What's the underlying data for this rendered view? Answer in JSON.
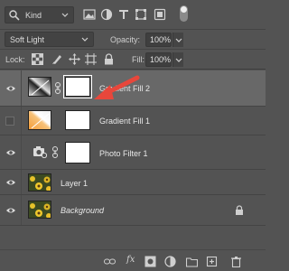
{
  "filter": {
    "kind_label": "Kind",
    "icons": [
      "image-filter-icon",
      "adjustment-filter-icon",
      "type-filter-icon",
      "shape-filter-icon",
      "smart-object-filter-icon",
      "filter-toggle"
    ]
  },
  "blend": {
    "mode": "Soft Light",
    "opacity_label": "Opacity:",
    "opacity_value": "100%"
  },
  "lock": {
    "label": "Lock:",
    "fill_label": "Fill:",
    "fill_value": "100%",
    "icons": [
      "lock-transparent-pixels-icon",
      "lock-image-pixels-icon",
      "lock-position-icon",
      "lock-artboard-icon",
      "lock-all-icon"
    ]
  },
  "layers": [
    {
      "name": "Gradient Fill 2",
      "visible": true,
      "selected": true,
      "type": "gradient-fill",
      "italic": false
    },
    {
      "name": "Gradient Fill 1",
      "visible": false,
      "selected": false,
      "type": "gradient-fill",
      "italic": false
    },
    {
      "name": "Photo Filter 1",
      "visible": true,
      "selected": false,
      "type": "photo-filter",
      "italic": false
    },
    {
      "name": "Layer 1",
      "visible": true,
      "selected": false,
      "type": "pixel",
      "italic": false
    },
    {
      "name": "Background",
      "visible": true,
      "selected": false,
      "type": "background",
      "italic": true,
      "locked": true
    }
  ],
  "footer_icons": [
    "link-layers-icon",
    "fx-icon",
    "add-mask-icon",
    "new-adjustment-icon",
    "new-group-icon",
    "new-layer-icon",
    "delete-icon"
  ],
  "colors": {
    "panel_bg": "#535353",
    "selected_row": "#686868",
    "arrow": "#e8473b",
    "gradient_orange": "#f39a33"
  }
}
